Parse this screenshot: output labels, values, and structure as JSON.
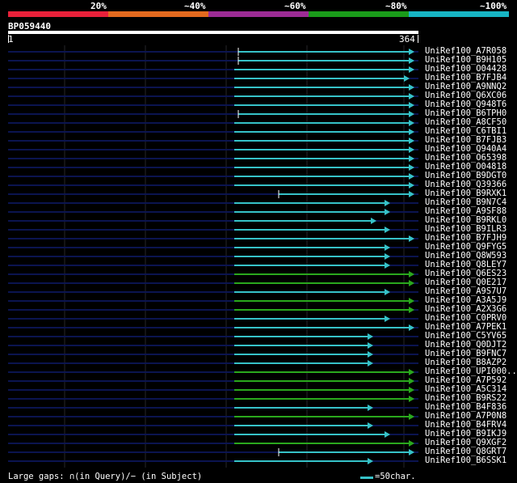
{
  "identity_legend": {
    "labels": [
      "20%",
      "~40%",
      "~60%",
      "~80%",
      "~100%"
    ],
    "colors": [
      "#e8213a",
      "#e36a1f",
      "#9c2c95",
      "#1a9b1a",
      "#17b5c4"
    ]
  },
  "query": {
    "id": "BP059440",
    "start": "1",
    "end": "364"
  },
  "colors": {
    "cyan": "#36c2c8",
    "green": "#2aa81d",
    "navy": "#0b1450",
    "grid": "#26262a"
  },
  "hits": [
    {
      "name": "UniRef100_A7R058",
      "start": 295,
      "end": 513,
      "color": "cyan",
      "tick": true
    },
    {
      "name": "UniRef100_B9H105",
      "start": 295,
      "end": 513,
      "color": "cyan",
      "tick": true
    },
    {
      "name": "UniRef100_O04428",
      "start": 290,
      "end": 513,
      "color": "cyan",
      "tick": false
    },
    {
      "name": "UniRef100_B7FJB4",
      "start": 290,
      "end": 507,
      "color": "cyan",
      "tick": false
    },
    {
      "name": "UniRef100_A9NNQ2",
      "start": 290,
      "end": 513,
      "color": "cyan",
      "tick": false
    },
    {
      "name": "UniRef100_Q6XC06",
      "start": 290,
      "end": 513,
      "color": "cyan",
      "tick": false
    },
    {
      "name": "UniRef100_Q948T6",
      "start": 290,
      "end": 513,
      "color": "cyan",
      "tick": false
    },
    {
      "name": "UniRef100_B6TPH0",
      "start": 295,
      "end": 513,
      "color": "cyan",
      "tick": true
    },
    {
      "name": "UniRef100_A8CF50",
      "start": 290,
      "end": 513,
      "color": "cyan",
      "tick": false
    },
    {
      "name": "UniRef100_C6TBI1",
      "start": 290,
      "end": 513,
      "color": "cyan",
      "tick": false
    },
    {
      "name": "UniRef100_B7FJB3",
      "start": 290,
      "end": 513,
      "color": "cyan",
      "tick": false
    },
    {
      "name": "UniRef100_Q940A4",
      "start": 290,
      "end": 513,
      "color": "cyan",
      "tick": false
    },
    {
      "name": "UniRef100_O65398",
      "start": 290,
      "end": 513,
      "color": "cyan",
      "tick": false
    },
    {
      "name": "UniRef100_O04818",
      "start": 290,
      "end": 513,
      "color": "cyan",
      "tick": false
    },
    {
      "name": "UniRef100_B9DGT0",
      "start": 290,
      "end": 513,
      "color": "cyan",
      "tick": false
    },
    {
      "name": "UniRef100_Q39366",
      "start": 290,
      "end": 513,
      "color": "cyan",
      "tick": false
    },
    {
      "name": "UniRef100_B9RXK1",
      "start": 345,
      "end": 513,
      "color": "cyan",
      "tick": true
    },
    {
      "name": "UniRef100_B9N7C4",
      "start": 290,
      "end": 483,
      "color": "cyan",
      "tick": false
    },
    {
      "name": "UniRef100_A9SF88",
      "start": 290,
      "end": 483,
      "color": "cyan",
      "tick": false
    },
    {
      "name": "UniRef100_B9RKL0",
      "start": 290,
      "end": 466,
      "color": "cyan",
      "tick": false
    },
    {
      "name": "UniRef100_B9ILR3",
      "start": 290,
      "end": 483,
      "color": "cyan",
      "tick": false
    },
    {
      "name": "UniRef100_B7FJH9",
      "start": 290,
      "end": 513,
      "color": "cyan",
      "tick": false
    },
    {
      "name": "UniRef100_Q9FYG5",
      "start": 290,
      "end": 483,
      "color": "cyan",
      "tick": false
    },
    {
      "name": "UniRef100_Q8W593",
      "start": 290,
      "end": 483,
      "color": "cyan",
      "tick": false
    },
    {
      "name": "UniRef100_Q8LEY7",
      "start": 290,
      "end": 483,
      "color": "cyan",
      "tick": false
    },
    {
      "name": "UniRef100_Q6ES23",
      "start": 290,
      "end": 513,
      "color": "green",
      "tick": false
    },
    {
      "name": "UniRef100_Q0E217",
      "start": 290,
      "end": 513,
      "color": "green",
      "tick": false
    },
    {
      "name": "UniRef100_A9S7U7",
      "start": 290,
      "end": 483,
      "color": "cyan",
      "tick": false
    },
    {
      "name": "UniRef100_A3A5J9",
      "start": 290,
      "end": 513,
      "color": "green",
      "tick": false
    },
    {
      "name": "UniRef100_A2X3G6",
      "start": 290,
      "end": 513,
      "color": "green",
      "tick": false
    },
    {
      "name": "UniRef100_C0PRV0",
      "start": 290,
      "end": 483,
      "color": "cyan",
      "tick": false
    },
    {
      "name": "UniRef100_A7PEK1",
      "start": 290,
      "end": 513,
      "color": "cyan",
      "tick": false
    },
    {
      "name": "UniRef100_C5YV65",
      "start": 290,
      "end": 462,
      "color": "cyan",
      "tick": false
    },
    {
      "name": "UniRef100_Q0DJT2",
      "start": 290,
      "end": 462,
      "color": "cyan",
      "tick": false
    },
    {
      "name": "UniRef100_B9FNC7",
      "start": 290,
      "end": 462,
      "color": "cyan",
      "tick": false
    },
    {
      "name": "UniRef100_B8AZP2",
      "start": 290,
      "end": 462,
      "color": "cyan",
      "tick": false
    },
    {
      "name": "UniRef100_UPI000..",
      "start": 290,
      "end": 513,
      "color": "green",
      "tick": false
    },
    {
      "name": "UniRef100_A7P592",
      "start": 290,
      "end": 513,
      "color": "green",
      "tick": false
    },
    {
      "name": "UniRef100_A5C314",
      "start": 290,
      "end": 513,
      "color": "green",
      "tick": false
    },
    {
      "name": "UniRef100_B9RS22",
      "start": 290,
      "end": 513,
      "color": "green",
      "tick": false
    },
    {
      "name": "UniRef100_B4F836",
      "start": 290,
      "end": 462,
      "color": "cyan",
      "tick": false
    },
    {
      "name": "UniRef100_A7P0N8",
      "start": 290,
      "end": 513,
      "color": "green",
      "tick": false
    },
    {
      "name": "UniRef100_B4FRV4",
      "start": 290,
      "end": 462,
      "color": "cyan",
      "tick": false
    },
    {
      "name": "UniRef100_B9IKJ9",
      "start": 290,
      "end": 483,
      "color": "cyan",
      "tick": false
    },
    {
      "name": "UniRef100_Q9XGF2",
      "start": 290,
      "end": 513,
      "color": "green",
      "tick": false
    },
    {
      "name": "UniRef100_Q8GRT7",
      "start": 345,
      "end": 513,
      "color": "cyan",
      "tick": true
    },
    {
      "name": "UniRef100_B6SSK1",
      "start": 290,
      "end": 462,
      "color": "cyan",
      "tick": false
    }
  ],
  "footer": {
    "left": "Large gaps: ∩(in Query)/− (in Subject)",
    "right": "=50char."
  }
}
